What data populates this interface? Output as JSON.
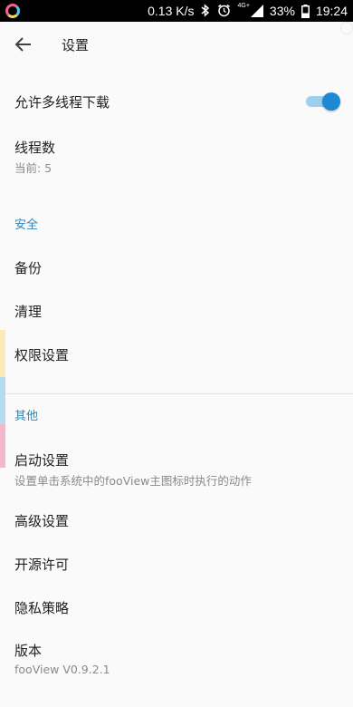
{
  "status_bar": {
    "network_speed": "0.13 K/s",
    "network_badge": "4G+",
    "battery": "33%",
    "time": "19:24",
    "icons": [
      "bluetooth-icon",
      "alarm-icon",
      "signal-icon",
      "battery-icon"
    ]
  },
  "app_bar": {
    "title": "设置",
    "back_icon": "arrow-back-icon"
  },
  "settings": {
    "multithread": {
      "title": "允许多线程下载",
      "enabled": true
    },
    "thread_count": {
      "title": "线程数",
      "subtitle": "当前: 5"
    },
    "security_header": "安全",
    "backup": {
      "title": "备份"
    },
    "cleanup": {
      "title": "清理"
    },
    "permissions": {
      "title": "权限设置"
    },
    "other_header": "其他",
    "launch": {
      "title": "启动设置",
      "subtitle": "设置单击系统中的fooView主图标时执行的动作"
    },
    "advanced": {
      "title": "高级设置"
    },
    "open_source": {
      "title": "开源许可"
    },
    "privacy": {
      "title": "隐私策略"
    },
    "version": {
      "title": "版本",
      "subtitle": "fooView V0.9.2.1"
    }
  },
  "colors": {
    "accent": "#1e88d2",
    "section_header": "#2a86b8",
    "edge_strips": [
      "#fbe9b7",
      "#b3dcef",
      "#f3b8cf"
    ]
  }
}
